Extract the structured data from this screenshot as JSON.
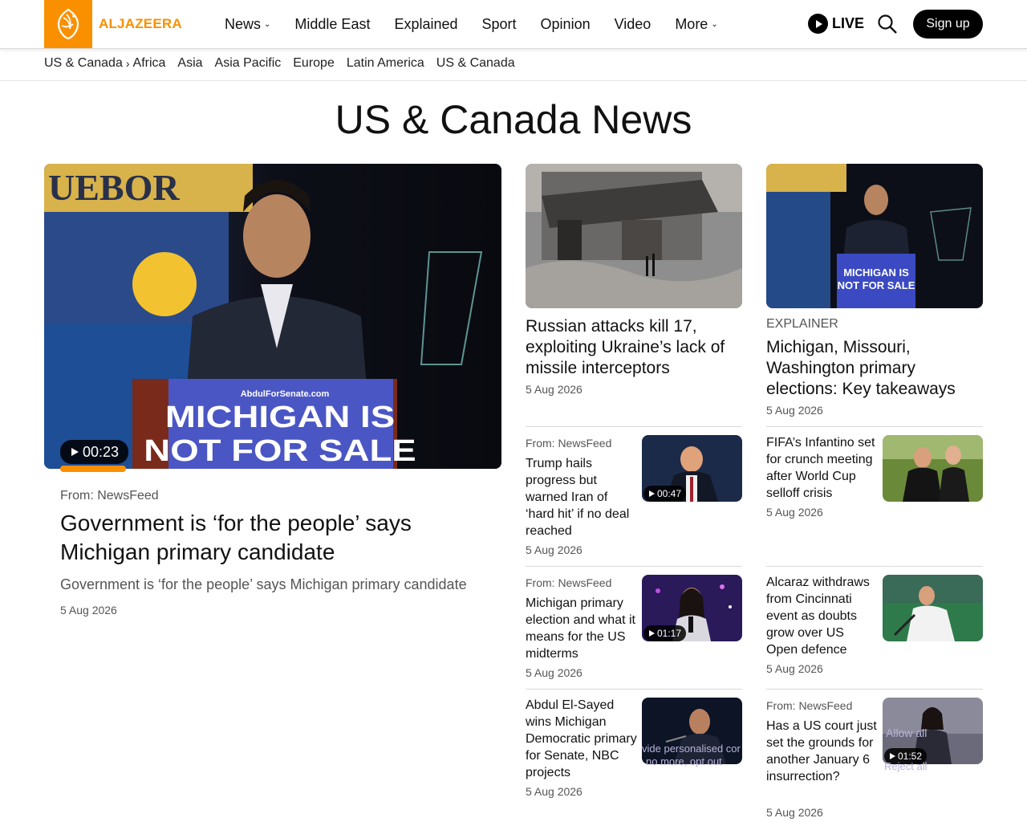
{
  "brand": {
    "name": "ALJAZEERA",
    "color": "#fa9000"
  },
  "nav": {
    "items": [
      {
        "label": "News",
        "dropdown": true
      },
      {
        "label": "Middle East",
        "dropdown": false
      },
      {
        "label": "Explained",
        "dropdown": false
      },
      {
        "label": "Sport",
        "dropdown": false
      },
      {
        "label": "Opinion",
        "dropdown": false
      },
      {
        "label": "Video",
        "dropdown": false
      },
      {
        "label": "More",
        "dropdown": true
      }
    ],
    "live_label": "LIVE",
    "signup_label": "Sign up"
  },
  "subnav": {
    "current": "US & Canada",
    "items": [
      "Africa",
      "Asia",
      "Asia Pacific",
      "Europe",
      "Latin America",
      "US & Canada"
    ]
  },
  "page_title": "US & Canada News",
  "feature": {
    "duration": "00:23",
    "from": "From: NewsFeed",
    "title": "Government is ‘for the people’ says Michigan primary candidate",
    "description": "Government is ‘for the people’ says Michigan primary candidate",
    "date": "5 Aug 2026",
    "image_text_1": "MICHIGAN IS",
    "image_text_2": "NOT FOR SALE",
    "image_text_3": "AbdulForSenate.com",
    "image_banner": "UEBOR"
  },
  "col2_top": {
    "title": "Russian attacks kill 17, exploiting Ukraine’s lack of missile interceptors",
    "date": "5 Aug 2026"
  },
  "col3_top": {
    "kicker": "EXPLAINER",
    "title": "Michigan, Missouri, Washington primary elections: Key takeaways",
    "date": "5 Aug 2026",
    "image_text_1": "MICHIGAN IS",
    "image_text_2": "NOT FOR SALE"
  },
  "col2_items": [
    {
      "from": "From: NewsFeed",
      "title": "Trump hails progress but warned Iran of ‘hard hit’ if no deal reached",
      "date": "5 Aug 2026",
      "duration": "00:47"
    },
    {
      "from": "From: NewsFeed",
      "title": "Michigan primary election and what it means for the US midterms",
      "date": "5 Aug 2026",
      "duration": "01:17"
    },
    {
      "title": "Abdul El-Sayed wins Michigan Democratic primary for Senate, NBC projects",
      "date": "5 Aug 2026"
    }
  ],
  "col3_items": [
    {
      "title": "FIFA’s Infantino set for crunch meeting after World Cup selloff crisis",
      "date": "5 Aug 2026"
    },
    {
      "title": "Alcaraz withdraws from Cincinnati event as doubts grow over US Open defence",
      "date": "5 Aug 2026"
    },
    {
      "from": "From: NewsFeed",
      "title": "Has a US court just set the grounds for another January 6 insurrection?",
      "date": "5 Aug 2026",
      "duration": "01:52"
    }
  ],
  "cookie": {
    "line1": "vide personalised cor",
    "line2": "no more, opt out",
    "allow": "Allow all",
    "reject": "Reject all"
  }
}
